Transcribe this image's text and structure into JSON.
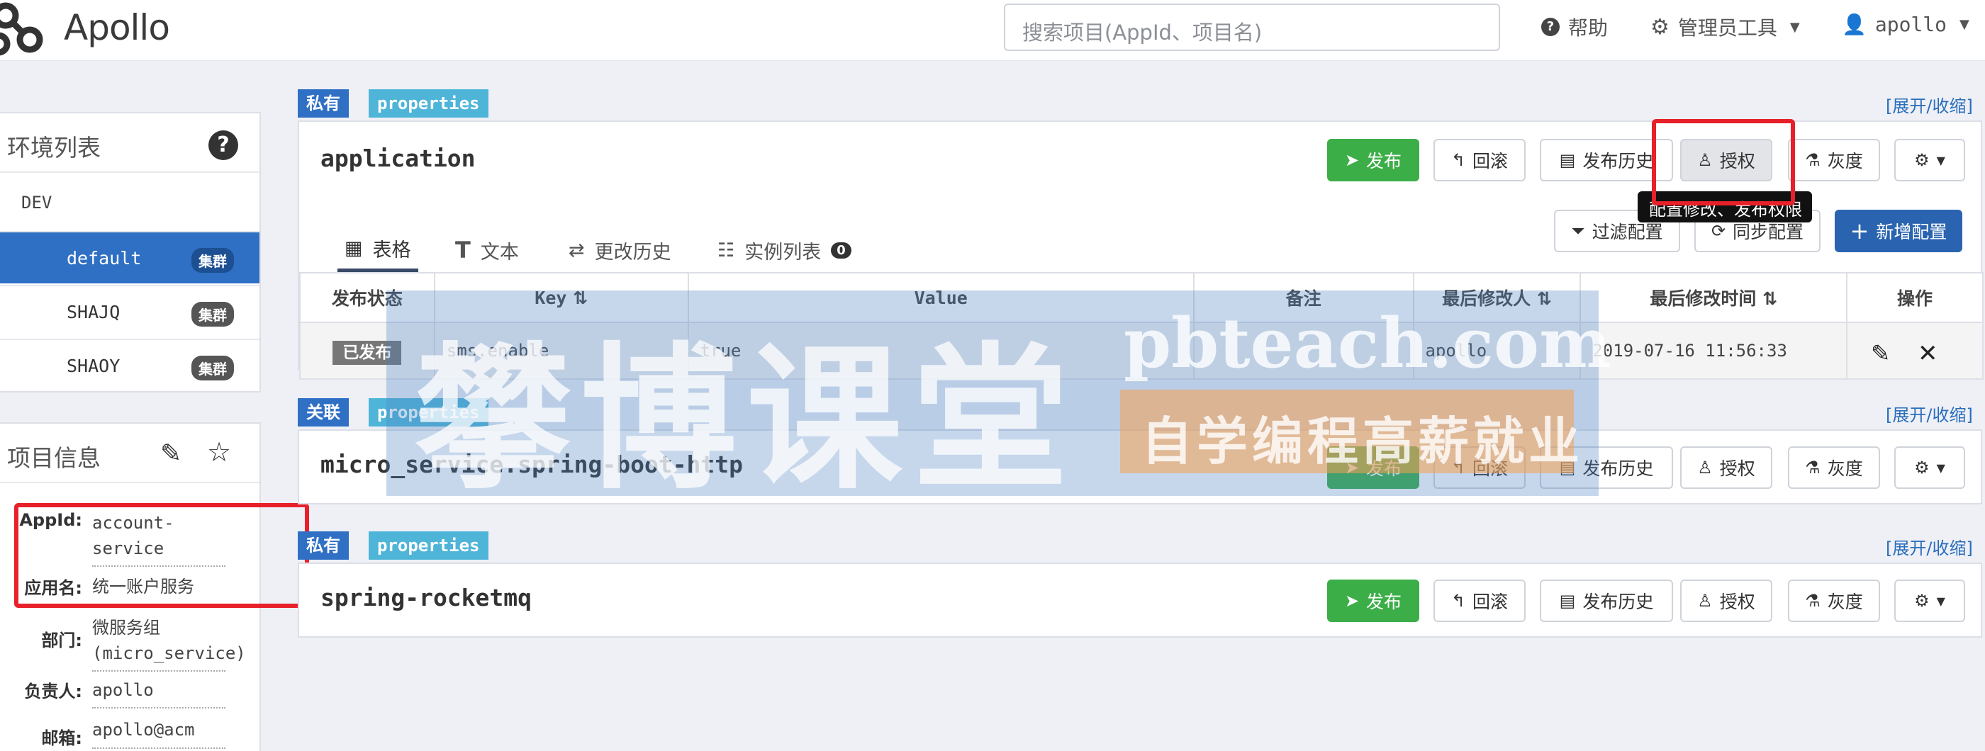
{
  "brand": "Apollo",
  "search": {
    "placeholder": "搜索项目(AppId、项目名)"
  },
  "nav": {
    "help": "帮助",
    "admin_tools": "管理员工具",
    "user": "apollo"
  },
  "env_panel": {
    "title": "环境列表",
    "env": "DEV",
    "clusters": [
      {
        "name": "default",
        "badge": "集群",
        "active": true
      },
      {
        "name": "SHAJQ",
        "badge": "集群",
        "active": false
      },
      {
        "name": "SHAOY",
        "badge": "集群",
        "active": false
      }
    ]
  },
  "project_info": {
    "title": "项目信息",
    "rows": [
      {
        "label": "AppId:",
        "value": "account-service"
      },
      {
        "label": "应用名:",
        "value": "统一账户服务"
      },
      {
        "label": "部门:",
        "value": "微服务组(micro_service)"
      },
      {
        "label": "负责人:",
        "value": "apollo"
      },
      {
        "label": "邮箱:",
        "value": "apollo@acm"
      }
    ]
  },
  "toggle_label": "[展开/收缩]",
  "namespaces": [
    {
      "scope": "私有",
      "format": "properties",
      "name": "application",
      "buttons": {
        "publish": "发布",
        "rollback": "回滚",
        "history": "发布历史",
        "grant": "授权",
        "gray": "灰度"
      },
      "tooltip": "配置修改、发布权限",
      "tabs": [
        {
          "label": "表格"
        },
        {
          "label": "文本"
        },
        {
          "label": "更改历史"
        },
        {
          "label": "实例列表",
          "count": "0"
        }
      ],
      "actions": {
        "filter": "过滤配置",
        "sync": "同步配置",
        "add": "新增配置"
      },
      "table": {
        "headers": [
          "发布状态",
          "Key",
          "Value",
          "备注",
          "最后修改人",
          "最后修改时间",
          "操作"
        ],
        "rows": [
          {
            "status": "已发布",
            "key": "sms.enable",
            "value": "true",
            "comment": "",
            "modifier": "apollo",
            "time": "2019-07-16 11:56:33"
          }
        ]
      }
    },
    {
      "scope": "关联",
      "format": "properties",
      "name": "micro_service.spring-boot-http",
      "buttons": {
        "publish": "发布",
        "rollback": "回滚",
        "history": "发布历史",
        "grant": "授权",
        "gray": "灰度"
      }
    },
    {
      "scope": "私有",
      "format": "properties",
      "name": "spring-rocketmq",
      "buttons": {
        "publish": "发布",
        "rollback": "回滚",
        "history": "发布历史",
        "grant": "授权",
        "gray": "灰度"
      }
    }
  ],
  "watermark": {
    "main": "攀博课堂",
    "url": "pbteach.com",
    "sub": "自学编程高薪就业"
  }
}
